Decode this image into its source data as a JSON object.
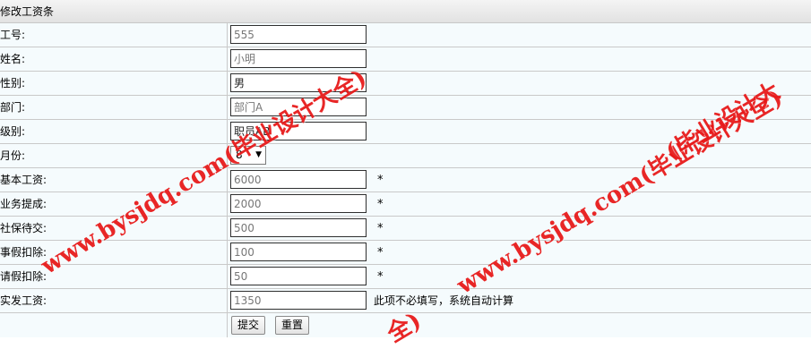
{
  "form": {
    "title": "修改工资条",
    "rows": [
      {
        "label": "工号:",
        "value": "555"
      },
      {
        "label": "姓名:",
        "value": "小明"
      },
      {
        "label": "性别:",
        "value": "男"
      },
      {
        "label": "部门:",
        "value": "部门A"
      },
      {
        "label": "级别:",
        "value": "职员AB"
      },
      {
        "label": "月份:",
        "value": "8"
      },
      {
        "label": "基本工资:",
        "value": "6000",
        "required": "*"
      },
      {
        "label": "业务提成:",
        "value": "2000",
        "required": "*"
      },
      {
        "label": "社保待交:",
        "value": "500",
        "required": "*"
      },
      {
        "label": "事假扣除:",
        "value": "100",
        "required": "*"
      },
      {
        "label": "请假扣除:",
        "value": "50",
        "required": "*"
      },
      {
        "label": "实发工资:",
        "value": "1350",
        "hint": "此项不必填写，系统自动计算"
      }
    ],
    "submit_label": "提交",
    "reset_label": "重置"
  },
  "watermarks": {
    "left": "www.bysjdq.com(毕业设计大全)",
    "right": "www.bysjdq.com(毕业设计大全)",
    "top_right": "(毕业设计大",
    "bottom": "全)"
  },
  "colors": {
    "row_bg": "#f5fbfd",
    "watermark": "#e61414"
  }
}
